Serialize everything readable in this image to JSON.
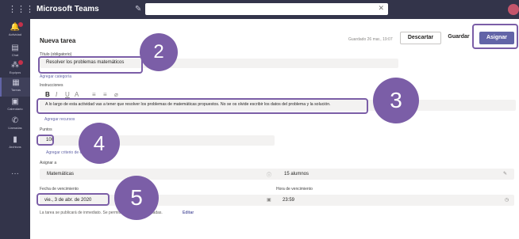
{
  "app": {
    "title": "Microsoft Teams"
  },
  "search": {
    "value": ""
  },
  "rail": {
    "items": [
      {
        "label": "Actividad"
      },
      {
        "label": "Chat"
      },
      {
        "label": "Equipos"
      },
      {
        "label": "Tareas"
      },
      {
        "label": "Calendario"
      },
      {
        "label": "Llamadas"
      },
      {
        "label": "Archivos"
      }
    ]
  },
  "form": {
    "title": "Nueva tarea",
    "saved": "Guardado 26 mar., 19:07",
    "discard_label": "Descartar",
    "save_label": "Guardar",
    "assign_label": "Asignar",
    "task_title_label": "Título (obligatorio)",
    "task_title_value": "Resolver los problemas matemáticos",
    "add_category": "Agregar categoría",
    "instructions_label": "Instrucciones",
    "instructions_value": "A lo largo de esta actividad vas a tener que resolver los problemas de matemáticas propuestos. No se os olvide escribir los datos del problema y la solución.",
    "add_resources": "Agregar recursos",
    "points_label": "Puntos",
    "points_value": "100",
    "add_rubric": "Agregar criterio de evaluación",
    "assign_to_label": "Asignar a",
    "class_value": "Matemáticas",
    "students_value": "15 alumnos",
    "due_date_label": "Fecha de vencimiento",
    "due_date_value": "vie., 3 de abr. de 2020",
    "due_time_label": "Hora de vencimiento",
    "due_time_value": "23:59",
    "publish_note": "La tarea se publicará de inmediato. Se permitirán entregas atrasadas.",
    "edit_link": "Editar"
  },
  "callouts": [
    "2",
    "3",
    "4",
    "5"
  ],
  "colors": {
    "rail": "#33344a",
    "accent": "#6264a7",
    "highlight": "#7b5ea7"
  }
}
